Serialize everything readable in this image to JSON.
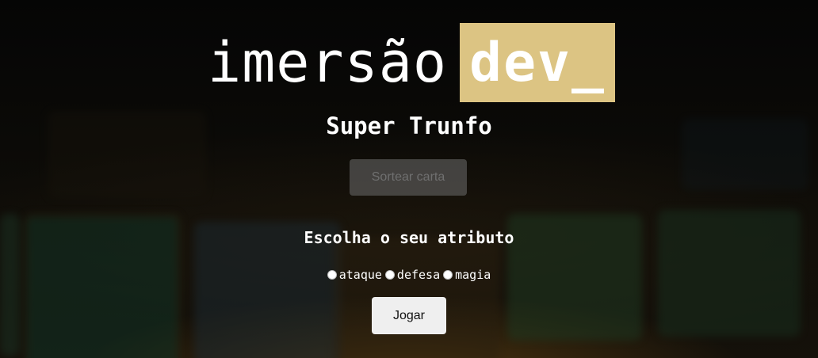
{
  "logo": {
    "word": "imersão",
    "box_text": "dev_",
    "box_color": "#dcc483"
  },
  "title": "Super Trunfo",
  "draw_button": {
    "label": "Sortear carta",
    "disabled": true
  },
  "attribute_section": {
    "heading": "Escolha o seu atributo",
    "options": [
      {
        "label": "ataque",
        "checked": false
      },
      {
        "label": "defesa",
        "checked": false
      },
      {
        "label": "magia",
        "checked": false
      }
    ]
  },
  "play_button": {
    "label": "Jogar"
  }
}
